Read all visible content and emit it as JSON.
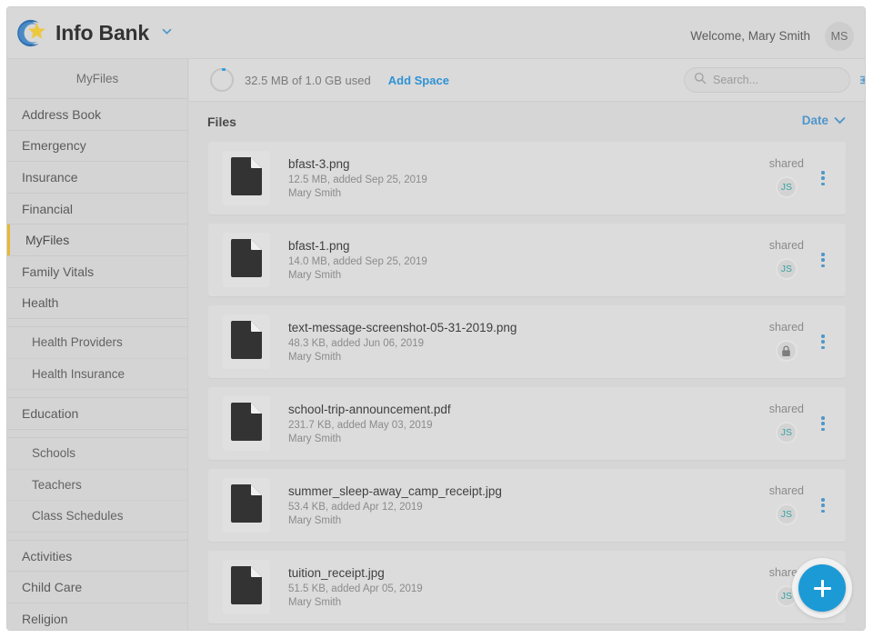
{
  "app": {
    "brand_title": "Info Bank",
    "brand_caret_icon": "chevron-down-icon",
    "logo_icon": "star-arc-logo",
    "welcome_text": "Welcome, Mary Smith",
    "avatar_initials": "MS"
  },
  "sidebar": {
    "header": "MyFiles",
    "items": [
      {
        "label": "Address Book",
        "level": "top",
        "active": false
      },
      {
        "label": "Emergency",
        "level": "top",
        "active": false
      },
      {
        "label": "Insurance",
        "level": "top",
        "active": false
      },
      {
        "label": "Financial",
        "level": "top",
        "active": false
      },
      {
        "label": "MyFiles",
        "level": "top",
        "active": true
      },
      {
        "label": "Family Vitals",
        "level": "top",
        "active": false
      },
      {
        "label": "Health",
        "level": "top",
        "active": false
      },
      {
        "label": "Health Providers",
        "level": "child",
        "active": false
      },
      {
        "label": "Health Insurance",
        "level": "child",
        "active": false
      },
      {
        "label": "Education",
        "level": "top",
        "active": false
      },
      {
        "label": "Schools",
        "level": "child",
        "active": false
      },
      {
        "label": "Teachers",
        "level": "child",
        "active": false
      },
      {
        "label": "Class Schedules",
        "level": "child",
        "active": false
      },
      {
        "label": "Activities",
        "level": "top",
        "active": false
      },
      {
        "label": "Child Care",
        "level": "top",
        "active": false
      },
      {
        "label": "Religion",
        "level": "top",
        "active": false
      }
    ]
  },
  "storage": {
    "usage_text": "32.5 MB of 1.0 GB used",
    "add_space_label": "Add Space",
    "percent_used": 3,
    "ring_icon": "storage-ring-icon"
  },
  "search": {
    "placeholder": "Search...",
    "value": "",
    "search_icon": "search-icon",
    "filter_icon": "filter-sliders-icon"
  },
  "files_panel": {
    "title": "Files",
    "sort_label": "Date",
    "sort_caret_icon": "chevron-down-icon"
  },
  "files": [
    {
      "name": "bfast-3.png",
      "details": "12.5 MB, added Sep 25, 2019",
      "owner": "Mary Smith",
      "share_label": "shared",
      "share_avatar": "JS",
      "share_type": "avatar",
      "file_icon": "document-icon",
      "menu_icon": "kebab-menu-icon"
    },
    {
      "name": "bfast-1.png",
      "details": "14.0 MB, added Sep 25, 2019",
      "owner": "Mary Smith",
      "share_label": "shared",
      "share_avatar": "JS",
      "share_type": "avatar",
      "file_icon": "document-icon",
      "menu_icon": "kebab-menu-icon"
    },
    {
      "name": "text-message-screenshot-05-31-2019.png",
      "details": "48.3 KB, added Jun 06, 2019",
      "owner": "Mary Smith",
      "share_label": "shared",
      "share_avatar": "",
      "share_type": "lock",
      "file_icon": "document-icon",
      "menu_icon": "kebab-menu-icon"
    },
    {
      "name": "school-trip-announcement.pdf",
      "details": "231.7 KB, added May 03, 2019",
      "owner": "Mary Smith",
      "share_label": "shared",
      "share_avatar": "JS",
      "share_type": "avatar",
      "file_icon": "document-icon",
      "menu_icon": "kebab-menu-icon"
    },
    {
      "name": "summer_sleep-away_camp_receipt.jpg",
      "details": "53.4 KB, added Apr 12, 2019",
      "owner": "Mary Smith",
      "share_label": "shared",
      "share_avatar": "JS",
      "share_type": "avatar",
      "file_icon": "document-icon",
      "menu_icon": "kebab-menu-icon"
    },
    {
      "name": "tuition_receipt.jpg",
      "details": "51.5 KB, added Apr 05, 2019",
      "owner": "Mary Smith",
      "share_label": "shared",
      "share_avatar": "JS",
      "share_type": "avatar",
      "file_icon": "document-icon",
      "menu_icon": "kebab-menu-icon"
    }
  ],
  "fab": {
    "icon": "plus-icon",
    "label": "+"
  },
  "colors": {
    "accent_blue": "#1b9ad6",
    "link_blue": "#2f93d4",
    "active_marker": "#e8b931",
    "avatar_teal": "#38a3a5",
    "page_bg": "#d6d6d6",
    "sidebar_bg": "#d4d4d4",
    "row_bg": "#dcdcdc"
  }
}
